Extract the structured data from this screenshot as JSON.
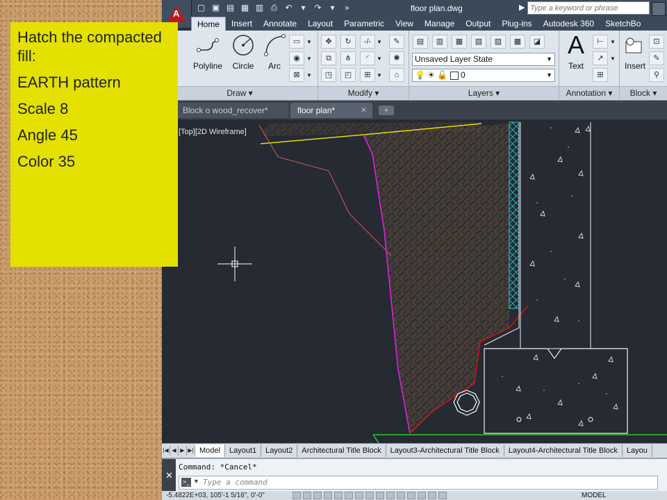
{
  "note": {
    "heading": "Hatch the compacted fill:",
    "lines": [
      "EARTH pattern",
      "Scale 8",
      "Angle 45",
      "Color 35"
    ]
  },
  "titlebar": {
    "document_title": "floor plan.dwg",
    "search_placeholder": "Type a keyword or phrase"
  },
  "ribbon_tabs": [
    "Home",
    "Insert",
    "Annotate",
    "Layout",
    "Parametric",
    "View",
    "Manage",
    "Output",
    "Plug-ins",
    "Autodesk 360",
    "SketchBo"
  ],
  "ribbon": {
    "draw": {
      "title": "Draw",
      "tools": [
        "ne",
        "Polyline",
        "Circle",
        "Arc"
      ]
    },
    "modify": {
      "title": "Modify"
    },
    "layers": {
      "title": "Layers",
      "layer_state": "Unsaved Layer State",
      "current_layer": "0"
    },
    "annotation": {
      "title": "Annotation",
      "text_tool": "Text"
    },
    "block": {
      "title": "Block",
      "insert_tool": "Insert"
    }
  },
  "file_tabs": [
    {
      "label": "Block o wood_recover*",
      "active": false
    },
    {
      "label": "floor plan*",
      "active": true
    }
  ],
  "viewport_label": "[Top][2D Wireframe]",
  "layout_tabs": [
    "Model",
    "Layout1",
    "Layout2",
    "Architectural Title Block",
    "Layout3-Architectural Title Block",
    "Layout4-Architectural Title Block",
    "Layou"
  ],
  "command": {
    "last": "Command: *Cancel*",
    "placeholder": "Type a command"
  },
  "status": {
    "coordinates": "-5.4822E+03, 105'-1 5/16\", 0'-0\"",
    "model_label": "MODEL"
  },
  "colors": {
    "note_bg": "#e4e000",
    "canvas_bg": "#252a33",
    "magenta_line": "#e020e0",
    "red_line": "#e01010",
    "yellow_line": "#e8e000",
    "cyan_hatch": "#20c8d0"
  }
}
